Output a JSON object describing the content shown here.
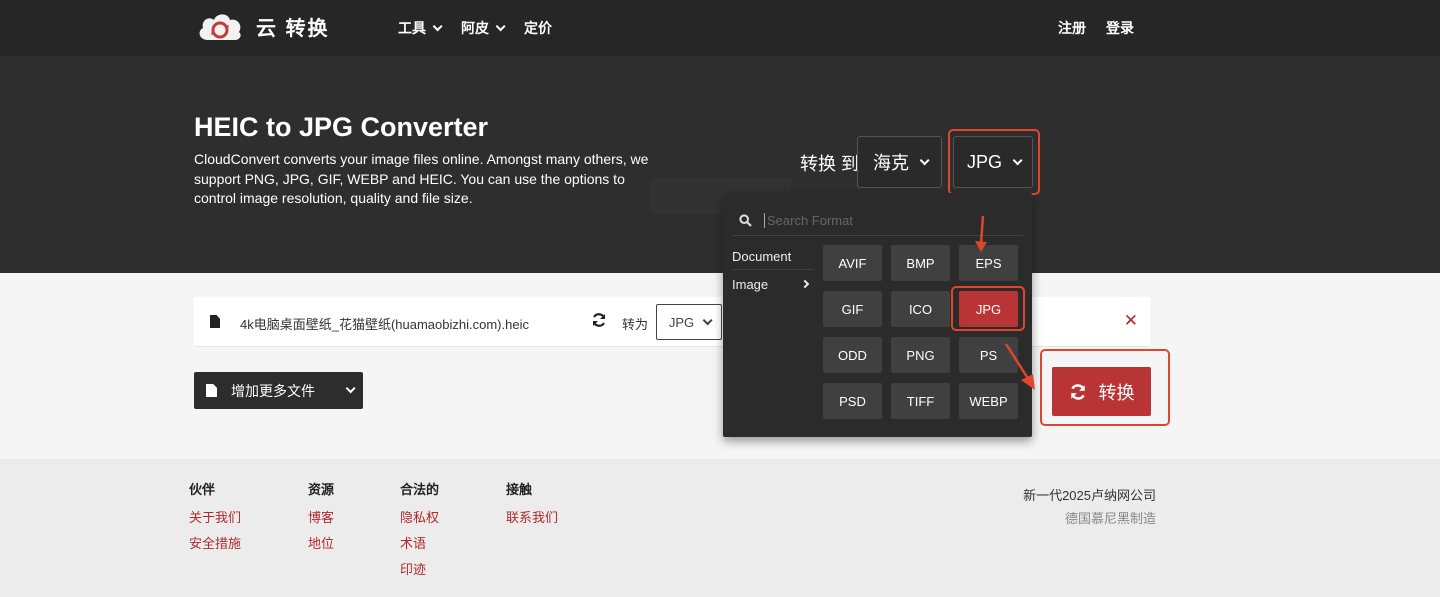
{
  "header": {
    "logo_text": "云 转换",
    "nav": [
      {
        "label": "工具",
        "has_dropdown": true
      },
      {
        "label": "阿皮",
        "has_dropdown": true
      },
      {
        "label": "定价",
        "has_dropdown": false
      }
    ],
    "auth": {
      "register": "注册",
      "login": "登录"
    }
  },
  "hero": {
    "title": "HEIC to JPG Converter",
    "description": "CloudConvert converts your image files online. Amongst many others, we support PNG, JPG, GIF, WEBP and HEIC. You can use the options to control image resolution, quality and file size.",
    "convert_to_label": "转换 到",
    "from_format": "海克",
    "to_format": "JPG"
  },
  "file": {
    "name": "4k电脑桌面壁纸_花猫壁纸(huamaobizhi.com).heic",
    "convert_label": "转为",
    "target": "JPG"
  },
  "add_files_label": "增加更多文件",
  "dropdown": {
    "search_placeholder": "Search Format",
    "categories": [
      "Document",
      "Image"
    ],
    "formats": [
      "AVIF",
      "BMP",
      "EPS",
      "GIF",
      "ICO",
      "JPG",
      "ODD",
      "PNG",
      "PS",
      "PSD",
      "TIFF",
      "WEBP"
    ],
    "selected": "JPG"
  },
  "convert_button": "转换",
  "footer": {
    "columns": [
      {
        "heading": "伙伴",
        "links": [
          "关于我们",
          "安全措施"
        ]
      },
      {
        "heading": "资源",
        "links": [
          "博客",
          "地位"
        ]
      },
      {
        "heading": "合法的",
        "links": [
          "隐私权",
          "术语",
          "印迹"
        ]
      },
      {
        "heading": "接触",
        "links": [
          "联系我们"
        ]
      }
    ],
    "company": "新一代2025卢纳网公司",
    "made_in": "德国慕尼黑制造"
  },
  "colors": {
    "accent": "#b93434",
    "highlight": "#e0462e",
    "dark": "#2e2e2e"
  }
}
